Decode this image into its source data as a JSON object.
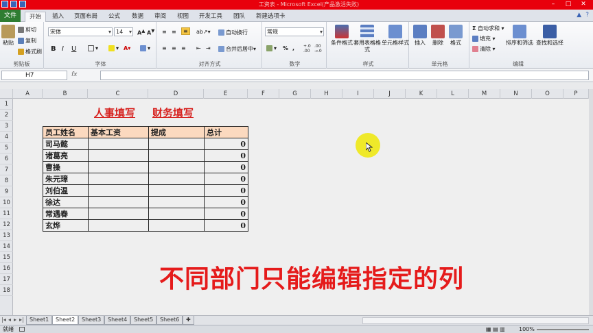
{
  "titlebar": {
    "title": "工资表 - Microsoft Excel(产品激活失败)",
    "minimize": "–",
    "maximize": "□",
    "close": "✕"
  },
  "tabs": [
    {
      "label": "文件"
    },
    {
      "label": "开始"
    },
    {
      "label": "插入"
    },
    {
      "label": "页面布局"
    },
    {
      "label": "公式"
    },
    {
      "label": "数据"
    },
    {
      "label": "审阅"
    },
    {
      "label": "视图"
    },
    {
      "label": "开发工具"
    },
    {
      "label": "团队"
    },
    {
      "label": "新建选项卡"
    }
  ],
  "ribbon": {
    "clipboard": {
      "group_label": "剪贴板",
      "paste": "粘贴",
      "cut": "剪切",
      "copy": "复制",
      "format_painter": "格式刷"
    },
    "font": {
      "group_label": "字体",
      "font_name": "宋体",
      "font_size": "14",
      "bold": "B",
      "italic": "I",
      "underline": "U"
    },
    "alignment": {
      "group_label": "对齐方式",
      "wrap": "自动换行",
      "merge": "合并后居中"
    },
    "number": {
      "group_label": "数字",
      "format": "常规",
      "percent": "%",
      "comma": ","
    },
    "styles": {
      "group_label": "样式",
      "conditional": "条件格式",
      "table": "套用表格格式",
      "cell": "单元格样式"
    },
    "cells": {
      "group_label": "单元格",
      "insert": "插入",
      "delete": "删除",
      "format": "格式"
    },
    "editing": {
      "group_label": "编辑",
      "autosum": "自动求和",
      "fill": "填充",
      "clear": "清除",
      "sort": "排序和筛选",
      "find": "查找和选择"
    }
  },
  "formula_bar": {
    "name_box": "H7",
    "fx": "fx",
    "value": ""
  },
  "columns": [
    "A",
    "B",
    "C",
    "D",
    "E",
    "F",
    "G",
    "H",
    "I",
    "J",
    "K",
    "L",
    "M",
    "N",
    "O",
    "P"
  ],
  "rows": [
    "1",
    "2",
    "3",
    "4",
    "5",
    "6",
    "7",
    "8",
    "9",
    "10",
    "11",
    "12",
    "13",
    "14",
    "15",
    "16",
    "17",
    "18"
  ],
  "labels": {
    "hr": "人事填写",
    "finance": "财务填写"
  },
  "table": {
    "headers": [
      "员工姓名",
      "基本工资",
      "提成",
      "总计"
    ],
    "rows": [
      {
        "name": "司马懿",
        "total": "0"
      },
      {
        "name": "诸葛亮",
        "total": "0"
      },
      {
        "name": "曹操",
        "total": "0"
      },
      {
        "name": "朱元璋",
        "total": "0"
      },
      {
        "name": "刘伯温",
        "total": "0"
      },
      {
        "name": "徐达",
        "total": "0"
      },
      {
        "name": "常遇春",
        "total": "0"
      },
      {
        "name": "玄烨",
        "total": "0"
      }
    ]
  },
  "caption": "不同部门只能编辑指定的列",
  "sheets": [
    "Sheet1",
    "Sheet2",
    "Sheet3",
    "Sheet4",
    "Sheet5",
    "Sheet6"
  ],
  "active_sheet": "Sheet2",
  "status": {
    "mode": "就绪",
    "zoom": "100%"
  },
  "colors": {
    "title_red": "#e8000c",
    "file_green": "#2e7d32",
    "header_fill": "#fbd9bf",
    "caption_red": "#e51b1b",
    "cursor_yellow": "#eee814"
  }
}
